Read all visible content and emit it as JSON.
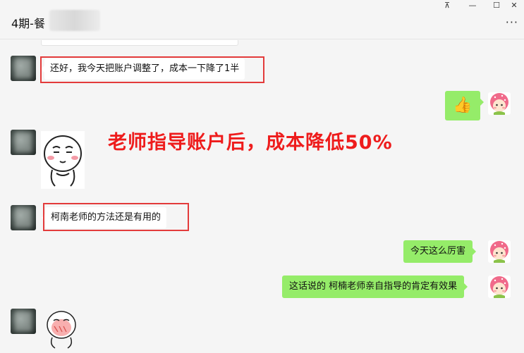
{
  "window": {
    "title": "4期-餐",
    "controls": [
      "pin-icon",
      "minimize-icon",
      "maximize-icon",
      "close-icon"
    ],
    "pin_glyph": "⊼",
    "minimize_glyph": "—",
    "maximize_glyph": "☐",
    "close_glyph": "✕",
    "more_glyph": "···"
  },
  "messages": [
    {
      "side": "left",
      "text": "还好，我今天把账户调整了，成本一下降了1半"
    },
    {
      "side": "right",
      "type": "emoji",
      "emoji": "thumbs-up-icon",
      "glyph": "👍"
    },
    {
      "side": "left",
      "type": "sticker",
      "sticker": "shy-face-sticker"
    },
    {
      "side": "left",
      "text": "柯南老师的方法还是有用的"
    },
    {
      "side": "right",
      "text": "今天这么厉害"
    },
    {
      "side": "right",
      "text": "这话说的 柯楠老师亲自指导的肯定有效果"
    },
    {
      "side": "left",
      "type": "sticker",
      "sticker": "blushing-face-sticker"
    }
  ],
  "annotation": {
    "headline": "老师指导账户后，成本降低50%",
    "color": "#ee1c1c"
  },
  "colors": {
    "background": "#f5f5f5",
    "my_bubble": "#95ec69",
    "other_bubble": "#ffffff",
    "highlight_box": "#e33b3b"
  }
}
